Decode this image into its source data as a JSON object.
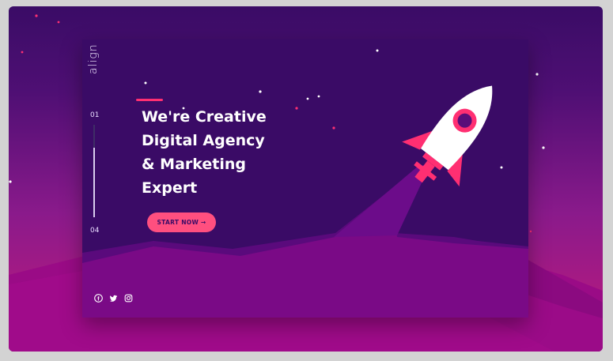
{
  "brand": {
    "logo_text": "align"
  },
  "hero": {
    "headline_lines": [
      "We're Creative",
      "Digital Agency",
      "& Marketing",
      "Expert"
    ],
    "cta_label": "START NOW →"
  },
  "progress": {
    "current": "01",
    "total": "04",
    "fraction": 0.25
  },
  "social": {
    "icons": [
      "facebook-icon",
      "twitter-icon",
      "instagram-icon"
    ]
  },
  "colors": {
    "accent": "#ff4f7f",
    "card_background": "#3a0b66",
    "mountain": "#7a0a86"
  },
  "illustration": {
    "subject": "rocket-icon"
  }
}
